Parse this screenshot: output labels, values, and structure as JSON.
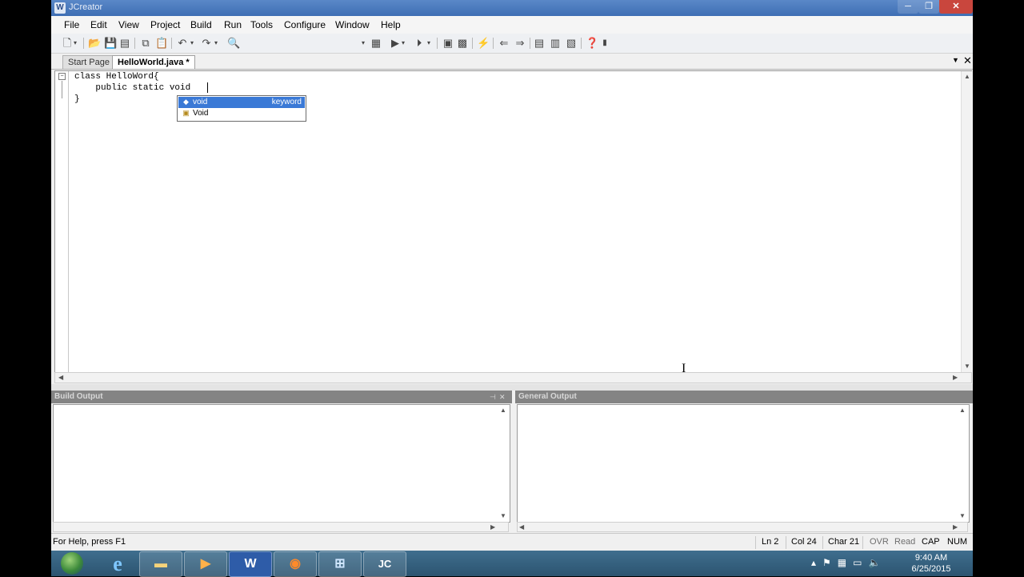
{
  "window": {
    "title": "JCreator"
  },
  "menu": [
    "File",
    "Edit",
    "View",
    "Project",
    "Build",
    "Run",
    "Tools",
    "Configure",
    "Window",
    "Help"
  ],
  "tabs": [
    {
      "label": "Start Page"
    },
    {
      "label": "HelloWorld.java *"
    }
  ],
  "editor": {
    "lines": [
      "class HelloWord{",
      "    public static void ",
      "}"
    ]
  },
  "autocomplete": {
    "items": [
      {
        "label": "void",
        "kind": "keyword",
        "icon": "keyword-icon",
        "selected": true
      },
      {
        "label": "Void",
        "kind": "",
        "icon": "class-icon",
        "selected": false
      }
    ]
  },
  "panels": {
    "left_title": "Build Output",
    "right_title": "General Output"
  },
  "status": {
    "help": "For Help, press F1",
    "ln": "Ln 2",
    "col": "Col 24",
    "char": "Char 21",
    "ovr": "OVR",
    "read": "Read",
    "cap": "CAP",
    "num": "NUM"
  },
  "taskbar": {
    "apps": [
      {
        "name": "internet-explorer-icon",
        "glyph": "e"
      },
      {
        "name": "file-explorer-icon",
        "glyph": "▬"
      },
      {
        "name": "media-player-icon",
        "glyph": "▶"
      },
      {
        "name": "word-icon",
        "glyph": "W"
      },
      {
        "name": "firefox-icon",
        "glyph": "◉"
      },
      {
        "name": "control-panel-icon",
        "glyph": "⊞"
      },
      {
        "name": "jcreator-icon",
        "glyph": "JC"
      }
    ],
    "time": "9:40 AM",
    "date": "6/25/2015"
  }
}
